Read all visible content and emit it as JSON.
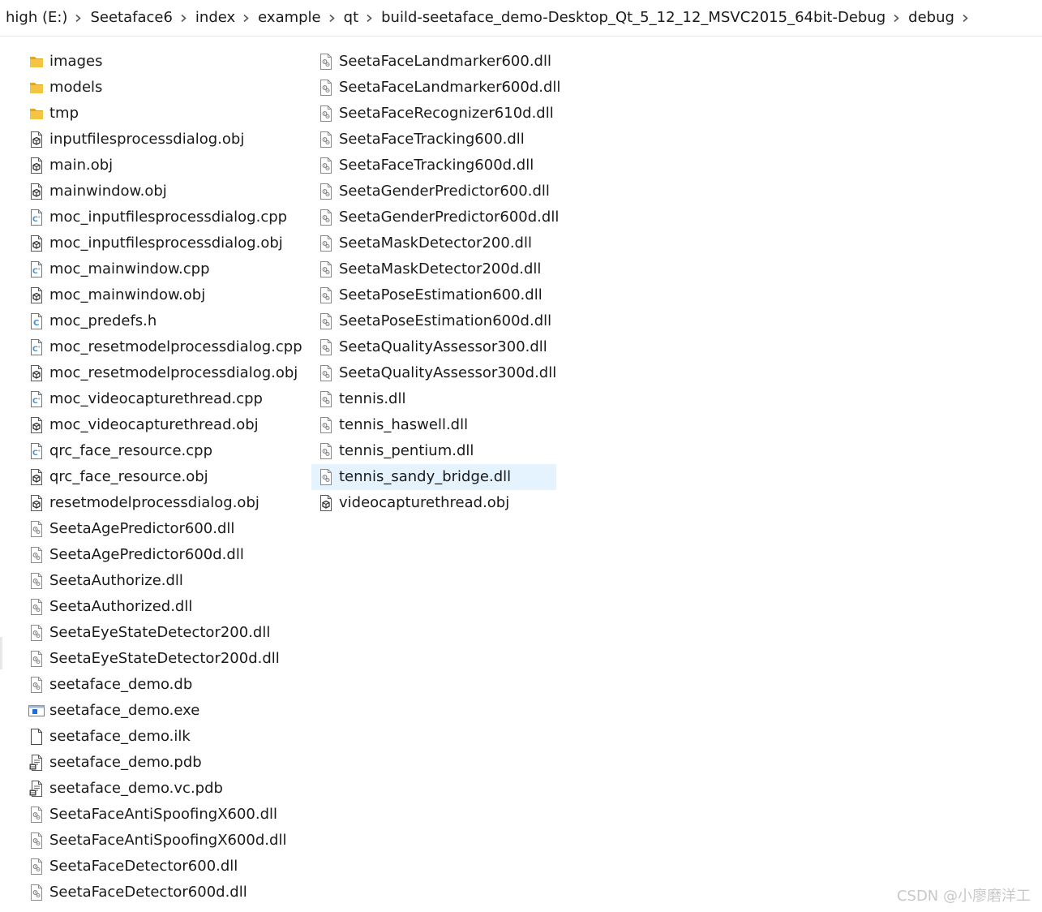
{
  "breadcrumb": [
    "high (E:)",
    "Seetaface6",
    "index",
    "example",
    "qt",
    "build-seetaface_demo-Desktop_Qt_5_12_12_MSVC2015_64bit-Debug",
    "debug"
  ],
  "columns": [
    [
      {
        "name": "images",
        "icon": "folder-icon"
      },
      {
        "name": "models",
        "icon": "folder-icon"
      },
      {
        "name": "tmp",
        "icon": "folder-icon"
      },
      {
        "name": "inputfilesprocessdialog.obj",
        "icon": "obj-file-icon"
      },
      {
        "name": "main.obj",
        "icon": "obj-file-icon"
      },
      {
        "name": "mainwindow.obj",
        "icon": "obj-file-icon"
      },
      {
        "name": "moc_inputfilesprocessdialog.cpp",
        "icon": "cpp-file-icon"
      },
      {
        "name": "moc_inputfilesprocessdialog.obj",
        "icon": "obj-file-icon"
      },
      {
        "name": "moc_mainwindow.cpp",
        "icon": "cpp-file-icon"
      },
      {
        "name": "moc_mainwindow.obj",
        "icon": "obj-file-icon"
      },
      {
        "name": "moc_predefs.h",
        "icon": "header-file-icon"
      },
      {
        "name": "moc_resetmodelprocessdialog.cpp",
        "icon": "cpp-file-icon"
      },
      {
        "name": "moc_resetmodelprocessdialog.obj",
        "icon": "obj-file-icon"
      },
      {
        "name": "moc_videocapturethread.cpp",
        "icon": "cpp-file-icon"
      },
      {
        "name": "moc_videocapturethread.obj",
        "icon": "obj-file-icon"
      },
      {
        "name": "qrc_face_resource.cpp",
        "icon": "cpp-file-icon"
      },
      {
        "name": "qrc_face_resource.obj",
        "icon": "obj-file-icon"
      },
      {
        "name": "resetmodelprocessdialog.obj",
        "icon": "obj-file-icon"
      },
      {
        "name": "SeetaAgePredictor600.dll",
        "icon": "dll-file-icon"
      },
      {
        "name": "SeetaAgePredictor600d.dll",
        "icon": "dll-file-icon"
      },
      {
        "name": "SeetaAuthorize.dll",
        "icon": "dll-file-icon"
      },
      {
        "name": "SeetaAuthorized.dll",
        "icon": "dll-file-icon"
      },
      {
        "name": "SeetaEyeStateDetector200.dll",
        "icon": "dll-file-icon"
      },
      {
        "name": "SeetaEyeStateDetector200d.dll",
        "icon": "dll-file-icon"
      },
      {
        "name": "seetaface_demo.db",
        "icon": "dll-file-icon"
      },
      {
        "name": "seetaface_demo.exe",
        "icon": "exe-file-icon"
      },
      {
        "name": "seetaface_demo.ilk",
        "icon": "blank-file-icon"
      },
      {
        "name": "seetaface_demo.pdb",
        "icon": "pdb-file-icon"
      },
      {
        "name": "seetaface_demo.vc.pdb",
        "icon": "pdb-file-icon"
      },
      {
        "name": "SeetaFaceAntiSpoofingX600.dll",
        "icon": "dll-file-icon"
      },
      {
        "name": "SeetaFaceAntiSpoofingX600d.dll",
        "icon": "dll-file-icon"
      },
      {
        "name": "SeetaFaceDetector600.dll",
        "icon": "dll-file-icon"
      },
      {
        "name": "SeetaFaceDetector600d.dll",
        "icon": "dll-file-icon"
      }
    ],
    [
      {
        "name": "SeetaFaceLandmarker600.dll",
        "icon": "dll-file-icon"
      },
      {
        "name": "SeetaFaceLandmarker600d.dll",
        "icon": "dll-file-icon"
      },
      {
        "name": "SeetaFaceRecognizer610d.dll",
        "icon": "dll-file-icon"
      },
      {
        "name": "SeetaFaceTracking600.dll",
        "icon": "dll-file-icon"
      },
      {
        "name": "SeetaFaceTracking600d.dll",
        "icon": "dll-file-icon"
      },
      {
        "name": "SeetaGenderPredictor600.dll",
        "icon": "dll-file-icon"
      },
      {
        "name": "SeetaGenderPredictor600d.dll",
        "icon": "dll-file-icon"
      },
      {
        "name": "SeetaMaskDetector200.dll",
        "icon": "dll-file-icon"
      },
      {
        "name": "SeetaMaskDetector200d.dll",
        "icon": "dll-file-icon"
      },
      {
        "name": "SeetaPoseEstimation600.dll",
        "icon": "dll-file-icon"
      },
      {
        "name": "SeetaPoseEstimation600d.dll",
        "icon": "dll-file-icon"
      },
      {
        "name": "SeetaQualityAssessor300.dll",
        "icon": "dll-file-icon"
      },
      {
        "name": "SeetaQualityAssessor300d.dll",
        "icon": "dll-file-icon"
      },
      {
        "name": "tennis.dll",
        "icon": "dll-file-icon"
      },
      {
        "name": "tennis_haswell.dll",
        "icon": "dll-file-icon"
      },
      {
        "name": "tennis_pentium.dll",
        "icon": "dll-file-icon"
      },
      {
        "name": "tennis_sandy_bridge.dll",
        "icon": "dll-file-icon",
        "selected": true
      },
      {
        "name": "videocapturethread.obj",
        "icon": "obj-file-icon"
      }
    ]
  ],
  "watermark": "CSDN @小廖磨洋工",
  "colors": {
    "selection": "#e5f3ff",
    "folder": "#f4c542",
    "folder_dark": "#dca92a",
    "cpp_accent": "#3d8fd6",
    "exe_accent": "#1e6fd9"
  }
}
